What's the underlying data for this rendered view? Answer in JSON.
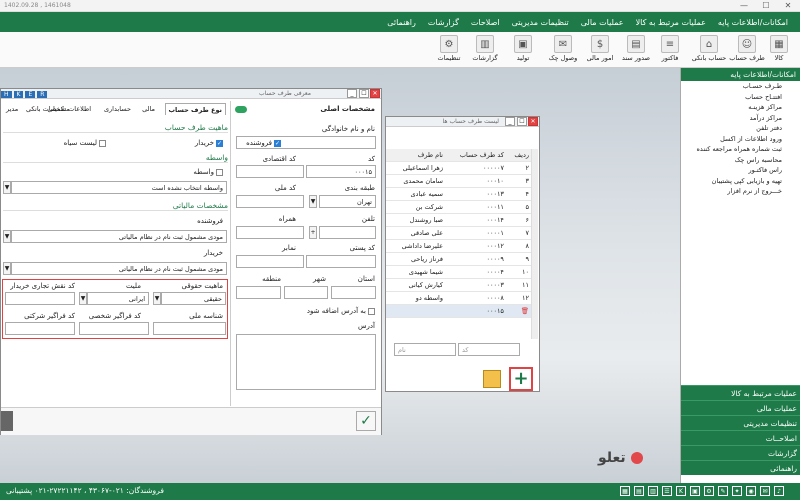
{
  "window": {
    "title": "1402.09.28 , 1461048",
    "minimize": "—",
    "maximize": "☐",
    "close": "✕"
  },
  "menu": [
    "امکانات/اطلاعات پایه",
    "عملیات مرتبط به کالا",
    "عملیات مالی",
    "تنظیمات مدیریتی",
    "اصلاحات",
    "گزارشات",
    "راهنمائی"
  ],
  "toolbar": [
    {
      "label": "کالا",
      "icon": "box-icon"
    },
    {
      "label": "طرف حساب",
      "icon": "person-icon"
    },
    {
      "label": "حساب بانکی",
      "icon": "bank-icon"
    },
    {
      "label": "فاکتور",
      "icon": "invoice-icon"
    },
    {
      "label": "صدور سند",
      "icon": "document-icon"
    },
    {
      "label": "امور مالی",
      "icon": "finance-icon"
    },
    {
      "label": "وصول چک",
      "icon": "cheque-icon"
    },
    {
      "label": "تولید",
      "icon": "production-icon"
    },
    {
      "label": "گزارشات",
      "icon": "report-icon"
    },
    {
      "label": "تنظیمات",
      "icon": "gear-icon"
    }
  ],
  "right_panel": {
    "header": "امکانات/اطلاعات پایه",
    "items": [
      "طـرف حسـاب",
      "افتتـاح حساب",
      "مراکز هزینـه",
      "مراکز درآمد",
      "دفتر تلفن",
      "ورود اطلاعات از اکسل",
      "ثبت شماره همراه مراجعه کننده",
      "محاسبه راس چک",
      "راس فاکتـور",
      "تهیه و بازیابی کپی پشتیبان",
      "خـــروج از نرم افزار"
    ],
    "sections": [
      "عملیات مرتبط به کالا",
      "عملیات مالی",
      "تنظیمات مدیریتی",
      "اصلاحــات",
      "گزارشات",
      "راهنمائی"
    ]
  },
  "list_window": {
    "title": "لیست طرف حساب ها",
    "columns": [
      "ردیف",
      "کد طرف حساب",
      "نام طرف"
    ],
    "rows": [
      [
        "۲",
        "۰۰۰۰۰۷",
        "زهرا اسماعیلی"
      ],
      [
        "۳",
        "۰۰۰۱۰",
        "سامان محمدی"
      ],
      [
        "۴",
        "۰۰۰۱۳",
        "سمیه عبادی"
      ],
      [
        "۵",
        "۰۰۰۱۱",
        "شرکت بن"
      ],
      [
        "۶",
        "۰۰۰۱۴",
        "صبا روشندل"
      ],
      [
        "۷",
        "۰۰۰۰۱",
        "علی صادقی"
      ],
      [
        "۸",
        "۰۰۰۱۲",
        "علیرضا داداشی"
      ],
      [
        "۹",
        "۰۰۰۰۹",
        "فرناز ریاحی"
      ],
      [
        "۱۰",
        "۰۰۰۰۴",
        "شیما شهیدی"
      ],
      [
        "۱۱",
        "۰۰۰۰۳",
        "کیارش کیانی"
      ],
      [
        "۱۲",
        "۰۰۰۰۸",
        "واسطه دو"
      ],
      [
        "",
        "۰۰۰۱۵",
        ""
      ]
    ],
    "search_code_placeholder": "کد",
    "search_name_placeholder": "نام",
    "add_label": "+"
  },
  "form": {
    "title": "معرفی طرف حساب",
    "main_info": "مشخصات اصلی",
    "name_label": "نام و نام خانوادگی",
    "code_label": "کد",
    "code_value": "۰۰۰۱۵",
    "economic_code_label": "کد اقتصادی",
    "floor_label": "طبقه بندی",
    "floor_value": "تهران",
    "national_code_label": "کد ملی",
    "phone_label": "تلفن",
    "mobile_label": "همراه",
    "postal_label": "کد پستی",
    "fax_label": "نمابر",
    "province_label": "استان",
    "city_label": "شهر",
    "region_label": "منطقه",
    "add_address_label": "به آدرس اضافه شود",
    "address_label": "آدرس",
    "tabs": [
      "نوع طرف حساب",
      "مالی",
      "حسابداری",
      "اطلاعات تکمیلی",
      "مشخصات بانکی",
      "مدیر"
    ],
    "nature_section": "ماهیت طرف حساب",
    "buyer": "خریدار",
    "seller": "فروشنده",
    "blacklist": "لیست سیاه",
    "broker_section": "واسطه",
    "broker_check": "واسطه",
    "broker_select": "واسطه انتخاب نشده است",
    "tax_section": "مشخصات مالیاتی",
    "seller_label": "فروشنده",
    "seller_tax": "مودی مشمول ثبت نام در نظام مالیاتی",
    "buyer_label": "خریدار",
    "buyer_tax": "مودی مشمول ثبت نام در نظام مالیاتی",
    "legal_nature_label": "ماهیت حقوقی",
    "legal_nature_value": "حقیقی",
    "nationality_label": "ملیت",
    "nationality_value": "ایرانی",
    "trade_role_label": "کد نقش تجاری خریدار",
    "national_id_label": "شناسه ملی",
    "personal_code_label": "کد فراگیر شخصی",
    "company_code_label": "کد فراگیر شرکتی",
    "confirm": "✓",
    "keys": [
      "H",
      "K",
      "E",
      "R"
    ]
  },
  "status": {
    "text": "فروشندگان: ۰۲۱-۴۳۰۶۷ ، ۲۷۲۲۱۱۴۲-۰۲۱ پشتیبانی"
  },
  "logo": "تعلو",
  "colors": {
    "primary": "#1e7a48",
    "accent": "#e2474b"
  }
}
